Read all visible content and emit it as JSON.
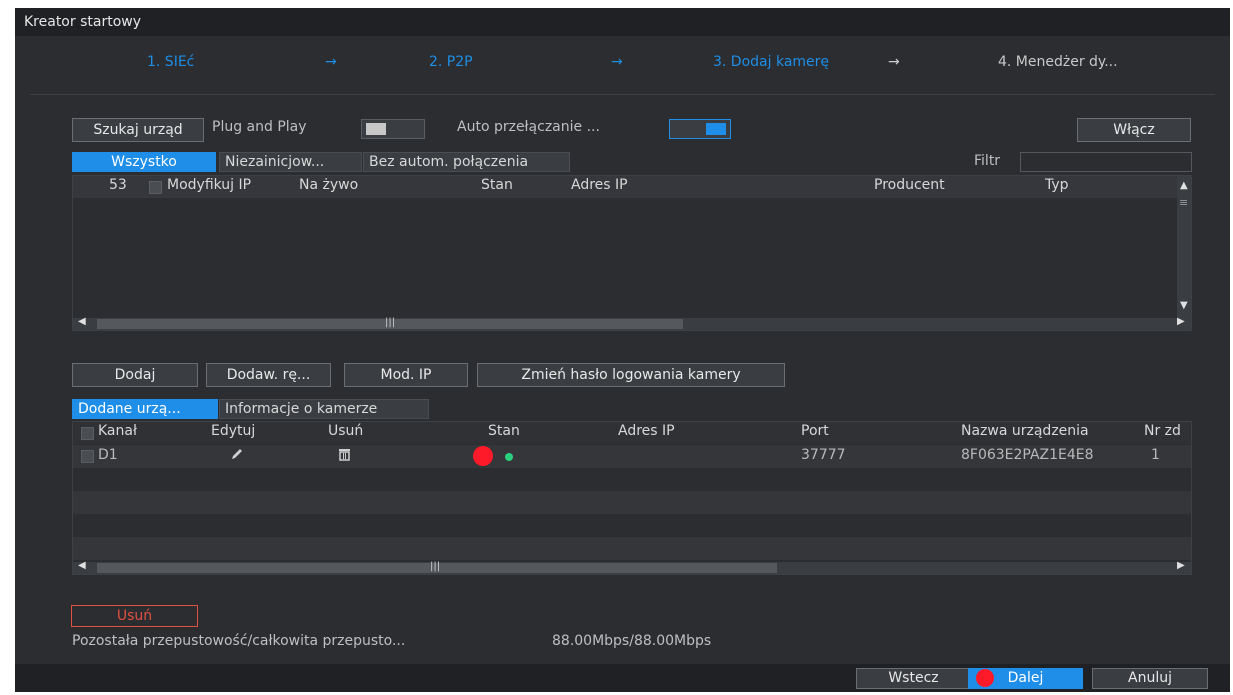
{
  "window": {
    "title": "Kreator startowy"
  },
  "steps": [
    {
      "label": "1. SIEć",
      "active": true
    },
    {
      "label": "2. P2P",
      "active": true
    },
    {
      "label": "3. Dodaj kamerę",
      "active": true
    },
    {
      "label": "4. Menedżer dy...",
      "active": false
    }
  ],
  "arrow_glyph": "→",
  "search": {
    "search_button": "Szukaj urząd",
    "plug_and_play_label": "Plug and Play",
    "plug_and_play_on": false,
    "auto_switch_label": "Auto przełączanie ...",
    "auto_switch_on": true,
    "enable_button": "Włącz"
  },
  "device_tabs": [
    "Wszystko",
    "Niezainicjow...",
    "Bez autom. połączenia"
  ],
  "filter_label": "Filtr",
  "found_table": {
    "count": "53",
    "columns": [
      "Modyfikuj IP",
      "Na żywo",
      "Stan",
      "Adres IP",
      "Producent",
      "Typ"
    ]
  },
  "actions": {
    "add": "Dodaj",
    "manual_add": "Dodaw. rę...",
    "modify_ip": "Mod. IP",
    "change_password": "Zmień hasło logowania kamery"
  },
  "added_tabs": [
    "Dodane urzą...",
    "Informacje o kamerze"
  ],
  "added_table": {
    "columns": [
      "Kanał",
      "Edytuj",
      "Usuń",
      "Stan",
      "Adres IP",
      "Port",
      "Nazwa urządzenia",
      "Nr zd"
    ],
    "rows": [
      {
        "channel": "D1",
        "ip": "",
        "port": "37777",
        "device_name": "8F063E2PAZ1E4E8",
        "nr": "1",
        "edit_icon": "pencil-icon",
        "delete_icon": "trash-icon",
        "status": "online"
      }
    ]
  },
  "delete_button": "Usuń",
  "bandwidth": {
    "label": "Pozostała przepustowość/całkowita przepusto...",
    "value": "88.00Mbps/88.00Mbps"
  },
  "footer": {
    "back": "Wstecz",
    "next": "Dalej",
    "cancel": "Anuluj"
  },
  "colors": {
    "accent": "#1f8ee8",
    "danger": "#e05040",
    "online": "#2bd07f",
    "marker": "#ff1a2a",
    "background": "#2b2d31"
  }
}
